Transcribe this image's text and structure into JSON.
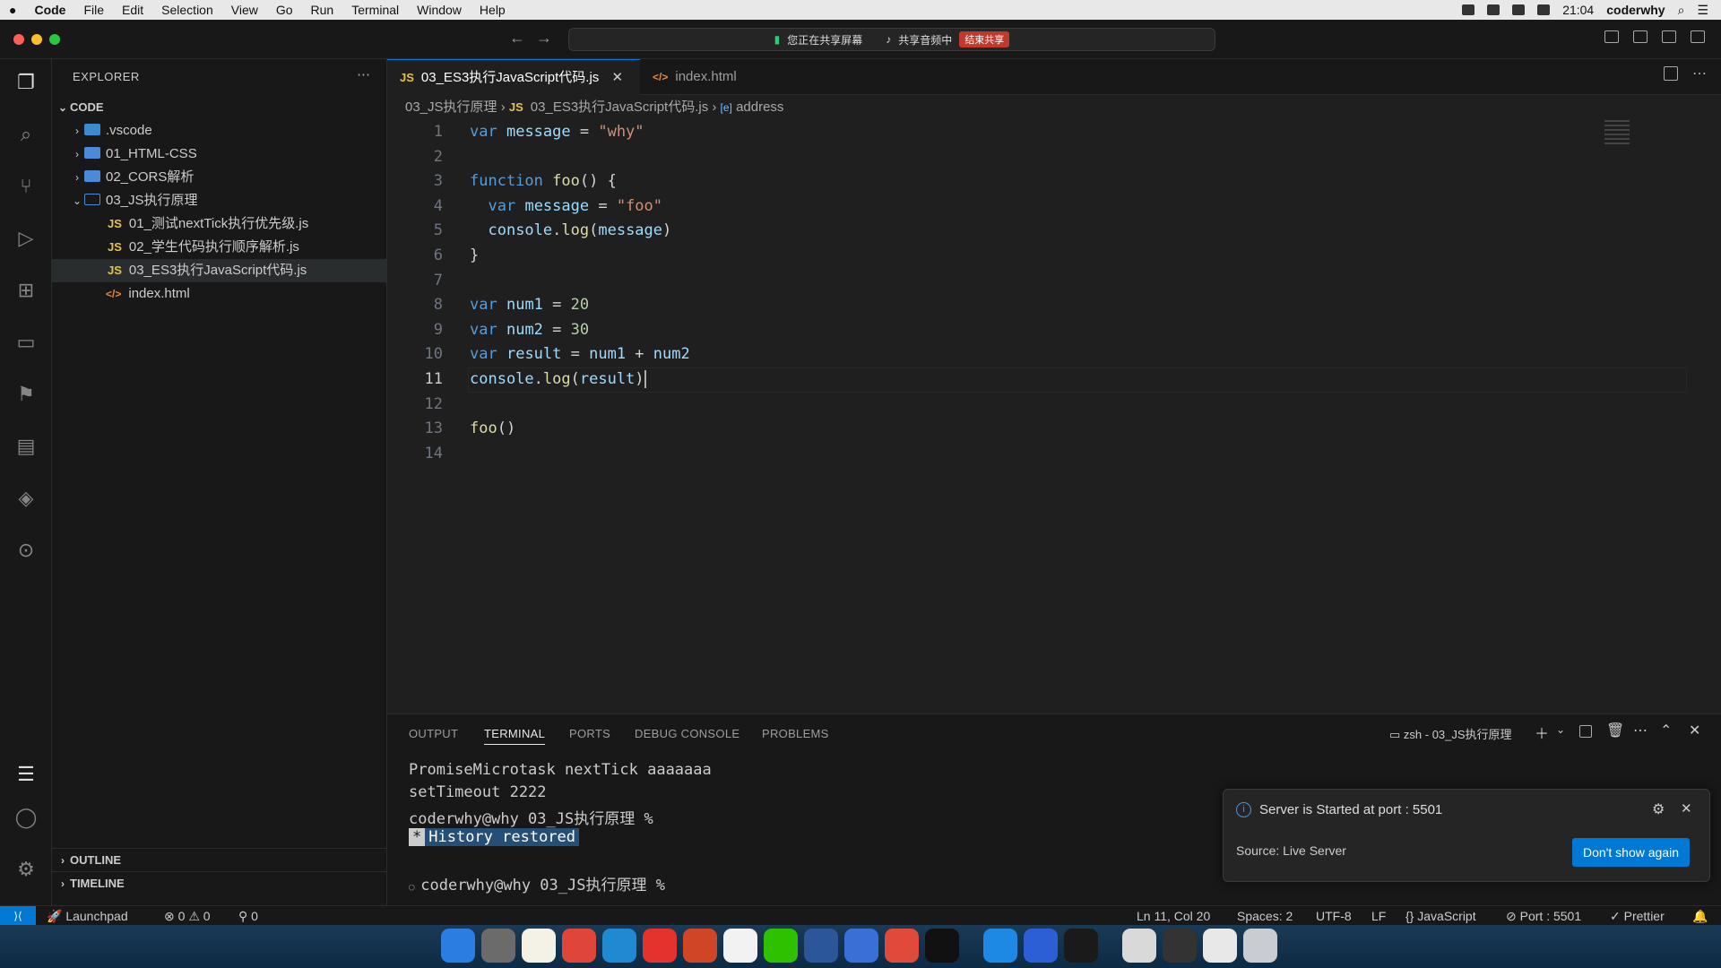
{
  "menubar": {
    "app": "Code",
    "items": [
      "File",
      "Edit",
      "Selection",
      "View",
      "Go",
      "Run",
      "Terminal",
      "Window",
      "Help"
    ],
    "clock": "21:04",
    "user": "coderwhy"
  },
  "screenshare": {
    "sharing": "您正在共享屏幕",
    "audio": "共享音频中",
    "stop": "结束共享"
  },
  "explorer": {
    "title": "EXPLORER",
    "root": "CODE",
    "items": [
      ".vscode",
      "01_HTML-CSS",
      "02_CORS解析",
      "03_JS执行原理",
      "01_测试nextTick执行优先级.js",
      "02_学生代码执行顺序解析.js",
      "03_ES3执行JavaScript代码.js",
      "index.html"
    ],
    "outline": "OUTLINE",
    "timeline": "TIMELINE"
  },
  "tabs": [
    "03_ES3执行JavaScript代码.js",
    "index.html"
  ],
  "breadcrumb": {
    "folder": "03_JS执行原理",
    "file": "03_ES3执行JavaScript代码.js",
    "symbol": "address"
  },
  "editor": {
    "line_numbers": [
      "1",
      "2",
      "3",
      "4",
      "5",
      "6",
      "7",
      "8",
      "9",
      "10",
      "11",
      "12",
      "13",
      "14"
    ],
    "current_line": "11"
  },
  "panel": {
    "tabs": [
      "OUTPUT",
      "TERMINAL",
      "PORTS",
      "DEBUG CONSOLE",
      "PROBLEMS"
    ],
    "terminal_name": "zsh - 03_JS执行原理",
    "lines": [
      "PromiseMicrotask nextTick aaaaaaa",
      "setTimeout 2222",
      "coderwhy@why 03_JS执行原理 %"
    ],
    "history_star": "*",
    "history": "History restored",
    "prompt2": "coderwhy@why 03_JS执行原理 %"
  },
  "notification": {
    "message": "Server is Started at port : 5501",
    "source": "Source: Live Server",
    "button": "Don't show again"
  },
  "statusbar": {
    "launchpad": "Launchpad",
    "errors": "0",
    "warnings": "0",
    "ports": "0",
    "position": "Ln 11, Col 20",
    "spaces": "Spaces: 2",
    "encoding": "UTF-8",
    "eol": "LF",
    "language": "JavaScript",
    "port": "Port : 5501",
    "prettier": "Prettier"
  },
  "colors": {
    "accent": "#0078d4",
    "keyword": "#569cd6",
    "function": "#dcdcaa",
    "string": "#ce9178",
    "number": "#b5cea8",
    "variable": "#9cdcfe"
  }
}
